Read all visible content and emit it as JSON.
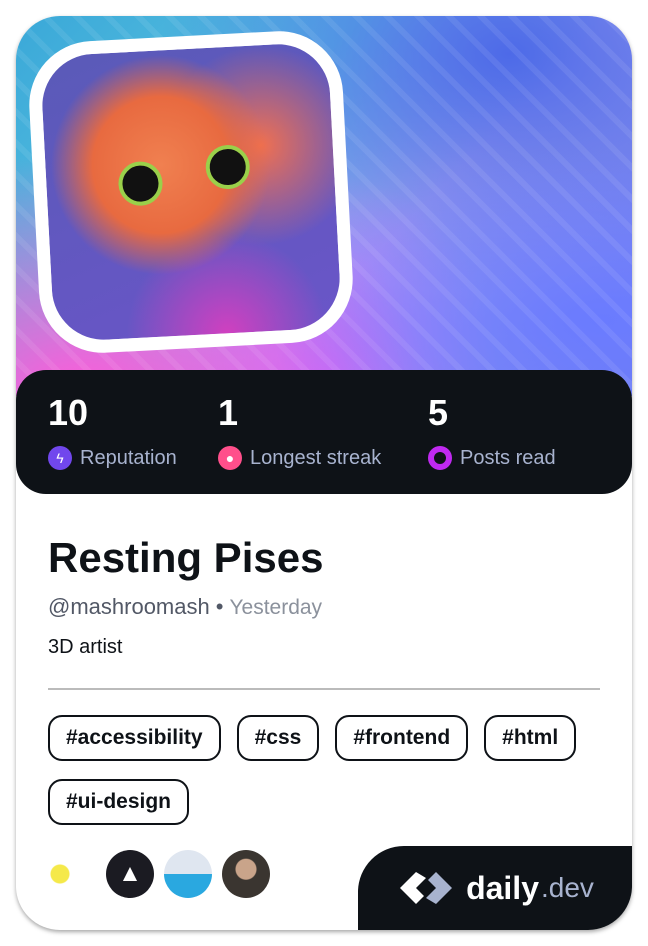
{
  "profile": {
    "name": "Resting Pises",
    "handle": "@mashroomash",
    "separator": "•",
    "joined": "Yesterday",
    "bio": "3D artist"
  },
  "stats": [
    {
      "value": "10",
      "label": "Reputation",
      "icon": "lightning-icon",
      "color": "#7147ed"
    },
    {
      "value": "1",
      "label": "Longest streak",
      "icon": "flame-icon",
      "color": "#ff4f8b"
    },
    {
      "value": "5",
      "label": "Posts read",
      "icon": "eye-icon",
      "color": "#c029f0"
    }
  ],
  "tags": [
    "#accessibility",
    "#css",
    "#frontend",
    "#html",
    "#ui-design"
  ],
  "sources": [
    "Front-end Tribe",
    "Astro",
    "Developer illustration",
    "Person avatar"
  ],
  "brand": {
    "name": "daily",
    "suffix": ".dev"
  }
}
